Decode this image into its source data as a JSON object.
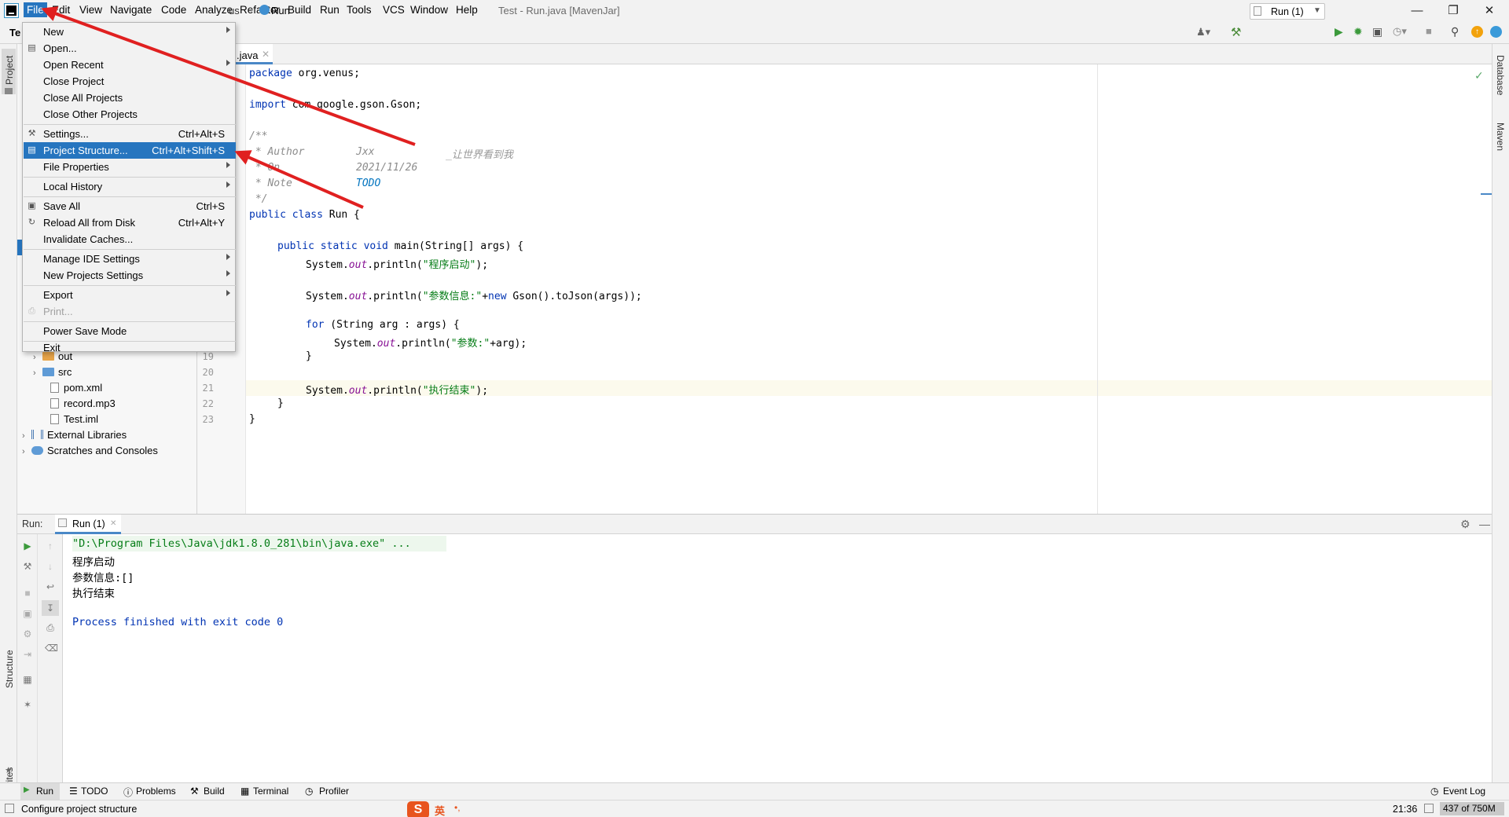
{
  "menubar": {
    "items": [
      "File",
      "Edit",
      "View",
      "Navigate",
      "Code",
      "Analyze",
      "Refactor",
      "Build",
      "Run",
      "Tools",
      "VCS",
      "Window",
      "Help"
    ],
    "window_title": "Test - Run.java [MavenJar]"
  },
  "navbar": {
    "crumb_partial": "us",
    "crumb_run": "Run",
    "run_config": "Run (1)"
  },
  "file_menu": {
    "items": [
      {
        "label": "New",
        "shortcut": "",
        "submenu": true
      },
      {
        "label": "Open...",
        "shortcut": "",
        "submenu": false
      },
      {
        "label": "Open Recent",
        "shortcut": "",
        "submenu": true
      },
      {
        "label": "Close Project",
        "shortcut": "",
        "submenu": false
      },
      {
        "label": "Close All Projects",
        "shortcut": "",
        "submenu": false
      },
      {
        "label": "Close Other Projects",
        "shortcut": "",
        "submenu": false
      },
      {
        "label": "Settings...",
        "shortcut": "Ctrl+Alt+S",
        "submenu": false
      },
      {
        "label": "Project Structure...",
        "shortcut": "Ctrl+Alt+Shift+S",
        "submenu": false
      },
      {
        "label": "File Properties",
        "shortcut": "",
        "submenu": true
      },
      {
        "label": "Local History",
        "shortcut": "",
        "submenu": true
      },
      {
        "label": "Save All",
        "shortcut": "Ctrl+S",
        "submenu": false
      },
      {
        "label": "Reload All from Disk",
        "shortcut": "Ctrl+Alt+Y",
        "submenu": false
      },
      {
        "label": "Invalidate Caches...",
        "shortcut": "",
        "submenu": false
      },
      {
        "label": "Manage IDE Settings",
        "shortcut": "",
        "submenu": true
      },
      {
        "label": "New Projects Settings",
        "shortcut": "",
        "submenu": true
      },
      {
        "label": "Export",
        "shortcut": "",
        "submenu": true
      },
      {
        "label": "Print...",
        "shortcut": "",
        "submenu": false
      },
      {
        "label": "Power Save Mode",
        "shortcut": "",
        "submenu": false
      },
      {
        "label": "Exit",
        "shortcut": "",
        "submenu": false
      }
    ]
  },
  "side_tabs": {
    "left_top": "Project",
    "left_structure": "Structure",
    "left_favorites": "Favorites",
    "right_database": "Database",
    "right_maven": "Maven"
  },
  "project_tree": {
    "partial_label": "Te",
    "items": [
      {
        "label": "out",
        "icon": "folder-orange"
      },
      {
        "label": "src",
        "icon": "folder-blue"
      },
      {
        "label": "pom.xml",
        "icon": "file"
      },
      {
        "label": "record.mp3",
        "icon": "file"
      },
      {
        "label": "Test.iml",
        "icon": "file"
      },
      {
        "label": "External Libraries",
        "icon": "library"
      },
      {
        "label": "Scratches and Consoles",
        "icon": "scratch"
      }
    ]
  },
  "editor": {
    "tab_label": ".java",
    "line_numbers": [
      "19",
      "20",
      "21",
      "22",
      "23"
    ],
    "lines": {
      "package_kw": "package",
      "package_name": " org.venus;",
      "import_kw": "import",
      "import_name": " com.google.gson.Gson;",
      "doc_open": "/**",
      "author_tag": " * Author",
      "author_val": "Jxx",
      "author_note": "_让世界看到我",
      "on_tag": " * On",
      "on_val": "2021/11/26",
      "note_tag": " * Note",
      "note_val": "TODO",
      "doc_close": " */",
      "class_kw": "public class",
      "class_name": " Run {",
      "main_kw": "public static void",
      "main_sig": " main(String[] args) {",
      "p1_pre": "System.",
      "p1_field": "out",
      "p1_post": ".println(",
      "p1_str": "\"程序启动\"",
      "p1_end": ");",
      "p2_pre": "System.",
      "p2_field": "out",
      "p2_post": ".println(",
      "p2_str": "\"参数信息:\"",
      "p2_plus": "+",
      "p2_new": "new",
      "p2_end": " Gson().toJson(args));",
      "for_kw": "for",
      "for_rest": " (String arg : args) {",
      "p3_pre": "System.",
      "p3_field": "out",
      "p3_post": ".println(",
      "p3_str": "\"参数:\"",
      "p3_end": "+arg);",
      "brace_1": "}",
      "p4_pre": "System.",
      "p4_field": "out",
      "p4_post": ".println(",
      "p4_str": "\"执行结束\"",
      "p4_end": ");",
      "brace_2": "}",
      "brace_3": "}"
    }
  },
  "run_window": {
    "label": "Run:",
    "tab": "Run (1)",
    "console": [
      "\"D:\\Program Files\\Java\\jdk1.8.0_281\\bin\\java.exe\" ...",
      "程序启动",
      "参数信息:[]",
      "执行结束",
      "",
      "Process finished with exit code 0"
    ]
  },
  "bottom_tabs": [
    "Run",
    "TODO",
    "Problems",
    "Build",
    "Terminal",
    "Profiler"
  ],
  "event_log": "Event Log",
  "status_bar": {
    "message": "Configure project structure",
    "ime": "英",
    "position": "21:36",
    "memory": "437 of 750M"
  },
  "colors": {
    "accent": "#2675bf",
    "annotation_arrow": "#e02020",
    "keyword": "#0033b3",
    "string": "#067d17"
  }
}
